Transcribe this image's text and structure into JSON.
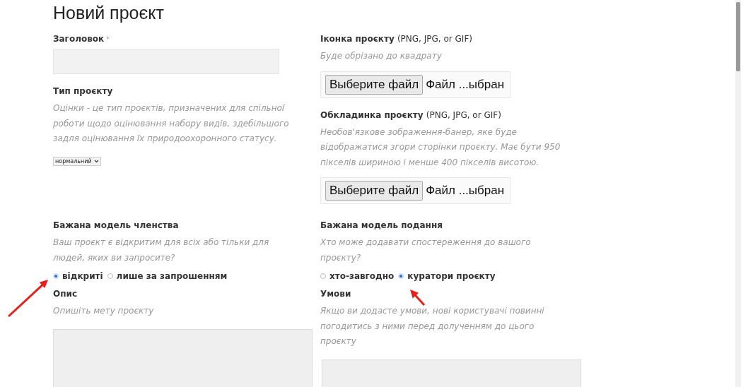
{
  "title": "Новий проєкт",
  "rows": [
    {
      "cells": [
        [
          {
            "kind": "text",
            "label": "Заголовок",
            "required_mark": "*"
          },
          {
            "kind": "select",
            "label": "Тип проєкту",
            "help": "Оцінки - це тип проєктів, призначених для спільної роботи щодо оцінювання набору видів, здебільшого задля оцінювання їх природоохоронного статусу.",
            "value": "нормальний"
          }
        ],
        [
          {
            "kind": "file",
            "label": "Іконка проєкту",
            "note": "(PNG, JPG, or GIF)",
            "help": "Буде обрізано до квадрату",
            "button": "Выберите файл",
            "status": "Файл ...ыбран"
          },
          {
            "kind": "file",
            "label": "Обкладинка проєкту",
            "note": "(PNG, JPG, or GIF)",
            "help": "Необов'язкове зображення-банер, яке буде відображатися згори сторінки проєкту. Має бути 950 пікселів шириною і менше 400 пікселів висотою.",
            "button": "Выберите файл",
            "status": "Файл ...ыбран"
          }
        ]
      ]
    },
    {
      "cells": [
        [
          {
            "kind": "radio",
            "label": "Бажана модель членства",
            "help": "Ваш проєкт є відкритим для всіх або тільки для людей, яких ви запросите?",
            "options": [
              {
                "label": "відкриті",
                "selected": true
              },
              {
                "label": "лише за запрошенням",
                "selected": false
              }
            ]
          }
        ],
        [
          {
            "kind": "radio",
            "label": "Бажана модель подання",
            "help": "Хто може додавати спостереження до вашого проєкту?",
            "options": [
              {
                "label": "хто-завгодно",
                "selected": false
              },
              {
                "label": "куратори проєкту",
                "selected": true
              }
            ]
          }
        ]
      ]
    },
    {
      "cells": [
        [
          {
            "kind": "textarea",
            "label": "Опис",
            "help": "Опишіть мету проєкту"
          }
        ],
        [
          {
            "kind": "textarea",
            "label": "Умови",
            "help": "Якщо ви додасте умови, нові користувачі повинні погодитись з ними перед долученням до цього проєкту"
          }
        ]
      ]
    }
  ]
}
